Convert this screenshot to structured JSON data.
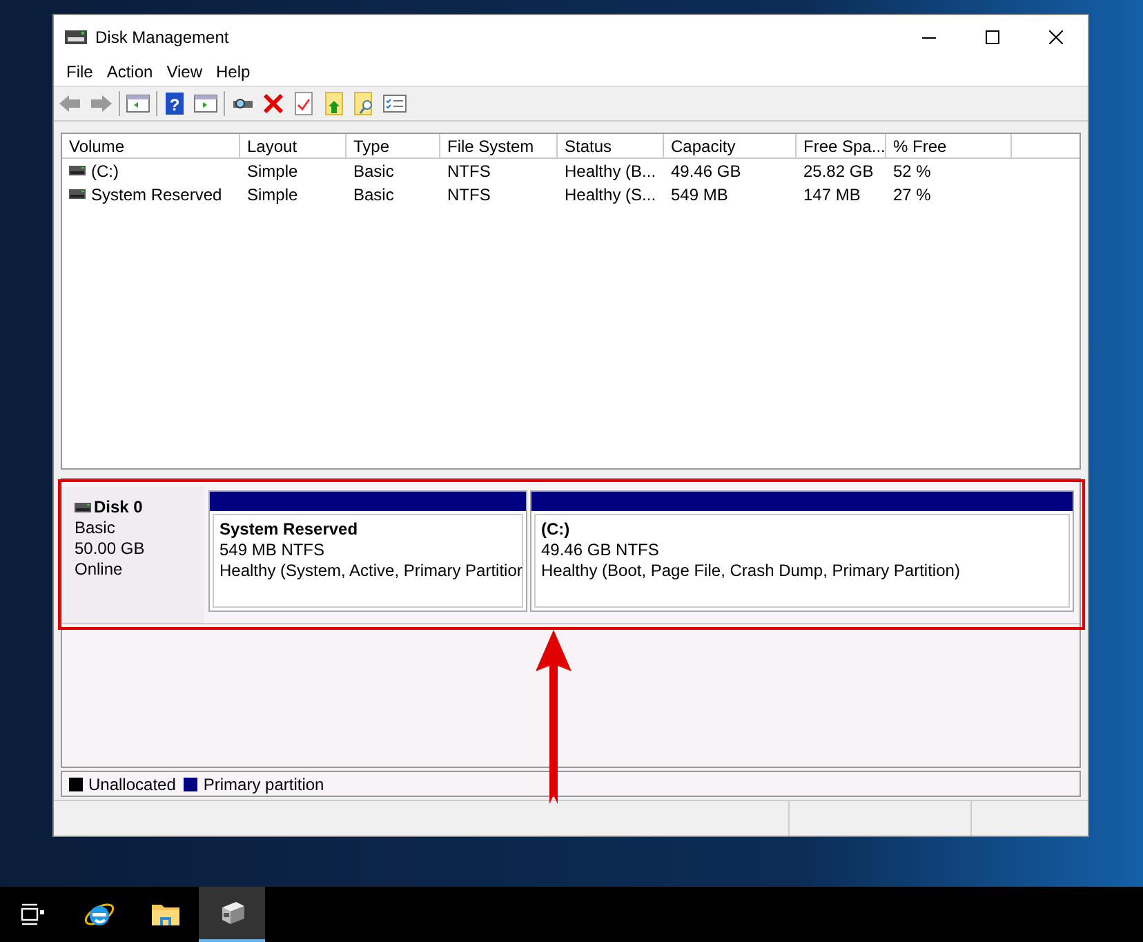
{
  "window": {
    "title": "Disk Management"
  },
  "menu": [
    "File",
    "Action",
    "View",
    "Help"
  ],
  "toolbar": {
    "help_glyph": "?"
  },
  "volumes": {
    "columns": [
      "Volume",
      "Layout",
      "Type",
      "File System",
      "Status",
      "Capacity",
      "Free Spa...",
      "% Free"
    ],
    "rows": [
      [
        "(C:)",
        "Simple",
        "Basic",
        "NTFS",
        "Healthy (B...",
        "49.46 GB",
        "25.82 GB",
        "52 %"
      ],
      [
        "System Reserved",
        "Simple",
        "Basic",
        "NTFS",
        "Healthy (S...",
        "549 MB",
        "147 MB",
        "27 %"
      ]
    ]
  },
  "disks": [
    {
      "name": "Disk 0",
      "type": "Basic",
      "size": "50.00 GB",
      "status": "Online",
      "partitions": [
        {
          "name": "System Reserved",
          "detail": "549 MB NTFS",
          "status": "Healthy (System, Active, Primary Partitior",
          "color": "#000080"
        },
        {
          "name": "(C:)",
          "detail": "49.46 GB NTFS",
          "status": "Healthy (Boot, Page File, Crash Dump, Primary Partition)",
          "color": "#000080"
        }
      ]
    }
  ],
  "legend": [
    {
      "label": "Unallocated",
      "color": "#000000"
    },
    {
      "label": "Primary partition",
      "color": "#000080"
    }
  ],
  "taskbar": [
    {
      "kind": "taskview",
      "selected": false
    },
    {
      "kind": "browser",
      "selected": false
    },
    {
      "kind": "folder",
      "selected": false
    },
    {
      "kind": "disk",
      "selected": true
    }
  ]
}
